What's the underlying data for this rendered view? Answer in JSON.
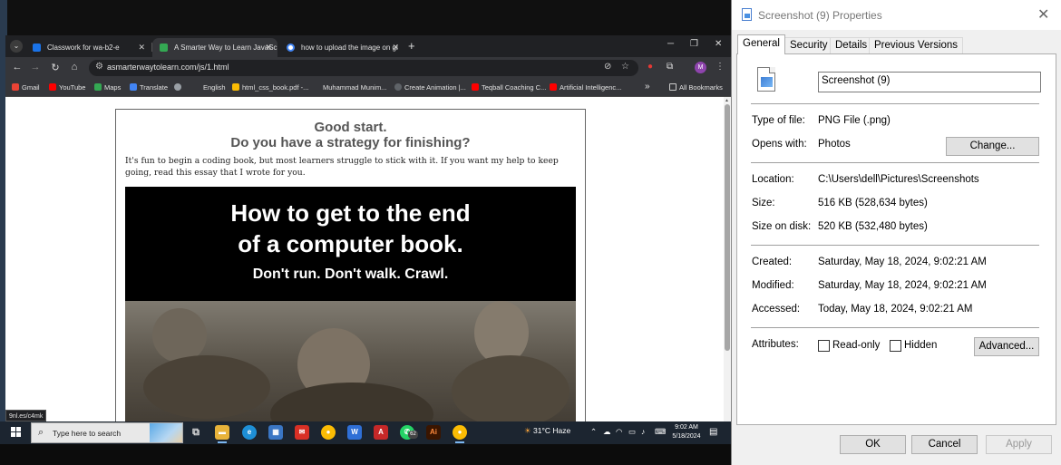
{
  "browser": {
    "tabs": [
      {
        "title": "Classwork for wa-b2-e",
        "favicon_color": "#1a73e8",
        "active": false
      },
      {
        "title": "A Smarter Way to Learn JavaSc",
        "favicon_color": "#34a853",
        "active": true
      },
      {
        "title": "how to upload the image on gi",
        "favicon_color": "#4285f4",
        "active": false
      }
    ],
    "url": "asmarterwaytolearn.com/js/1.html",
    "profile_initial": "M",
    "bookmarks": [
      {
        "label": "Gmail",
        "color": "#ea4335"
      },
      {
        "label": "YouTube",
        "color": "#ff0000"
      },
      {
        "label": "Maps",
        "color": "#34a853"
      },
      {
        "label": "Translate",
        "color": "#4285f4"
      },
      {
        "label": "",
        "color": "#9aa0a6"
      },
      {
        "label": "English",
        "color": ""
      },
      {
        "label": "html_css_book.pdf -...",
        "color": "#fbbc04"
      },
      {
        "label": "Muhammad Munim...",
        "color": ""
      },
      {
        "label": "Create Animation |...",
        "color": "#5f6368"
      },
      {
        "label": "Teqball Coaching C...",
        "color": "#ff0000"
      },
      {
        "label": "Artificial Intelligenc...",
        "color": "#ff0000"
      }
    ],
    "all_bookmarks": "All Bookmarks",
    "overflow": "»",
    "status_tooltip": "9nl.es/c4mk"
  },
  "page": {
    "heading_line1": "Good start.",
    "heading_line2": "Do you have a strategy for finishing?",
    "paragraph": "It's fun to begin a coding book, but most learners struggle to stick with it. If you want my help to keep going, read this essay that I wrote for you.",
    "banner_line1": "How to get to the end",
    "banner_line2": "of a computer book.",
    "banner_sub": "Don't run. Don't walk. Crawl."
  },
  "taskbar": {
    "search_placeholder": "Type here to search",
    "whatsapp_badge": "62",
    "weather": "31°C  Haze",
    "time": "9:02 AM",
    "date": "5/18/2024"
  },
  "dialog": {
    "title": "Screenshot (9) Properties",
    "tabs": [
      "General",
      "Security",
      "Details",
      "Previous Versions"
    ],
    "file_name": "Screenshot (9)",
    "type_label": "Type of file:",
    "type_value": "PNG File (.png)",
    "opens_label": "Opens with:",
    "opens_value": "Photos",
    "change_button": "Change...",
    "location_label": "Location:",
    "location_value": "C:\\Users\\dell\\Pictures\\Screenshots",
    "size_label": "Size:",
    "size_value": "516 KB (528,634 bytes)",
    "size_disk_label": "Size on disk:",
    "size_disk_value": "520 KB (532,480 bytes)",
    "created_label": "Created:",
    "created_value": "Saturday, May 18, 2024, 9:02:21 AM",
    "modified_label": "Modified:",
    "modified_value": "Saturday, May 18, 2024, 9:02:21 AM",
    "accessed_label": "Accessed:",
    "accessed_value": "Today, May 18, 2024, 9:02:21 AM",
    "attributes_label": "Attributes:",
    "readonly_label": "Read-only",
    "readonly_checked": false,
    "hidden_label": "Hidden",
    "hidden_checked": false,
    "advanced_button": "Advanced...",
    "ok_button": "OK",
    "cancel_button": "Cancel",
    "apply_button": "Apply"
  }
}
